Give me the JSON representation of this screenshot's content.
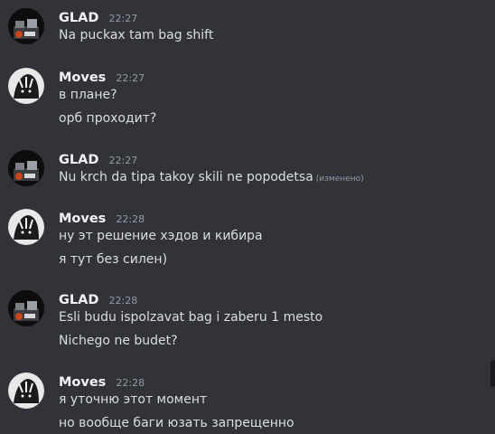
{
  "messages": [
    {
      "author": "GLAD",
      "time": "22:27",
      "avatar": "glad-avatar",
      "lines": [
        {
          "text": "Na puckax tam bag shift",
          "edited": ""
        }
      ]
    },
    {
      "author": "Moves",
      "time": "22:27",
      "avatar": "moves-avatar",
      "lines": [
        {
          "text": "в плане?",
          "edited": ""
        },
        {
          "text": "орб проходит?",
          "edited": ""
        }
      ]
    },
    {
      "author": "GLAD",
      "time": "22:27",
      "avatar": "glad-avatar",
      "lines": [
        {
          "text": "Nu krch da tipa takoy skili ne popodetsa",
          "edited": "(изменено)"
        }
      ]
    },
    {
      "author": "Moves",
      "time": "22:28",
      "avatar": "moves-avatar",
      "lines": [
        {
          "text": "ну эт решение хэдов и кибира",
          "edited": ""
        },
        {
          "text": "я тут без силен)",
          "edited": ""
        }
      ]
    },
    {
      "author": "GLAD",
      "time": "22:28",
      "avatar": "glad-avatar",
      "lines": [
        {
          "text": "Esli budu ispolzavat bag i zaberu 1 mesto",
          "edited": ""
        },
        {
          "text": "Nichego ne budet?",
          "edited": ""
        }
      ]
    },
    {
      "author": "Moves",
      "time": "22:28",
      "avatar": "moves-avatar",
      "lines": [
        {
          "text": "я уточню этот момент",
          "edited": ""
        },
        {
          "text": "но вообще баги юзать запрещенно",
          "edited": ""
        }
      ]
    }
  ]
}
